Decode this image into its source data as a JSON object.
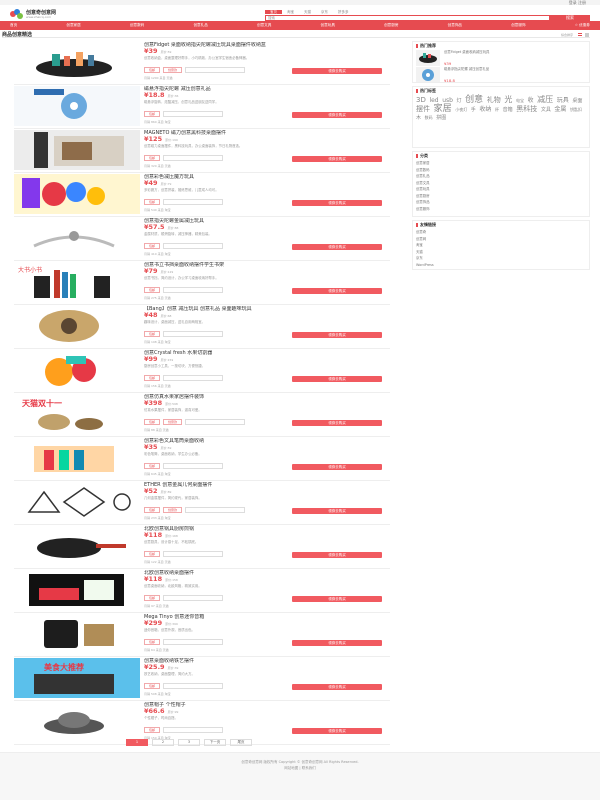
{
  "topbar": {
    "links": "登录  注册"
  },
  "header": {
    "logo_name": "创意奇创意网",
    "logo_sub": "www.zhaicq.com"
  },
  "search": {
    "tabs": [
      "宝贝",
      "淘宝",
      "天猫",
      "京东",
      "拼多多"
    ],
    "placeholder": "搜索",
    "button": "搜索"
  },
  "nav": {
    "items": [
      "首页",
      "创意家居",
      "创意数码",
      "创意礼品",
      "创意文具",
      "创意玩具",
      "创意厨房",
      "创意饰品",
      "创意服饰",
      "☆ 优惠券"
    ]
  },
  "page": {
    "title": "商品创意精选",
    "sort": "综合排序"
  },
  "items": [
    {
      "title": "创意Fidget 桌面收纳指尖陀螺减压玩具桌面摆件收纳盒",
      "price": "¥39",
      "orig": "原价:59",
      "desc": "创意收纳盒，桌面整理好帮手，小巧精致，办公室学生宿舍必备神器。",
      "tags": [
        "包邮",
        "创意款"
      ],
      "buy": "领券去购买",
      "meta": "月销 1200   来自 天猫"
    },
    {
      "title": "磁悬浮指尖陀螺 减压创意礼品",
      "price": "¥18.8",
      "orig": "原价:36",
      "desc": "磁悬浮旋转，炫酷减压，创意礼品送朋友送同学。",
      "tags": [
        "包邮"
      ],
      "buy": "领券去购买",
      "meta": "月销 860   来自 淘宝"
    },
    {
      "title": "MAGNETO 磁力创意黑科技桌面摆件",
      "price": "¥125",
      "orig": "原价:199",
      "desc": "创意磁力桌面摆件，黑科技玩具，办公桌面装饰，节日礼物首选。",
      "tags": [
        "包邮"
      ],
      "buy": "领券去购买",
      "meta": "月销 320   来自 天猫"
    },
    {
      "title": "创意彩色减压魔方玩具",
      "price": "¥49",
      "orig": "原价:79",
      "desc": "多彩魔方，创意拼装，锻炼思维，儿童成人均可。",
      "tags": [
        "包邮"
      ],
      "buy": "领券去购买",
      "meta": "月销 540   来自 淘宝"
    },
    {
      "title": "创意指尖陀螺金属减压玩具",
      "price": "¥57.5",
      "orig": "原价:88",
      "desc": "金属材质，顺滑旋转，减压神器，精美包装。",
      "tags": [
        "包邮"
      ],
      "buy": "领券去购买",
      "meta": "月销 410   来自 淘宝"
    },
    {
      "title": "创意书立书挡桌面收纳摆件学生书架",
      "price": "¥79",
      "orig": "原价:129",
      "desc": "创意书挡，简约设计，办公学习桌面收纳好帮手。",
      "tags": [
        "包邮"
      ],
      "buy": "领券去购买",
      "meta": "月销 275   来自 天猫"
    },
    {
      "title": "【Bang】创意 减压玩具 创意礼品 桌面趣味玩具",
      "price": "¥48",
      "orig": "原价:68",
      "desc": "趣味设计，桌面减压，送礼自用两相宜。",
      "tags": [
        "包邮"
      ],
      "buy": "领券去购买",
      "meta": "月销 198   来自 淘宝"
    },
    {
      "title": "创意Crystal fresh 水果切割器",
      "price": "¥99",
      "orig": "原价:159",
      "desc": "厨房创意小工具，一按切块，方便快捷。",
      "tags": [
        "包邮"
      ],
      "buy": "领券去购买",
      "meta": "月销 156   来自 天猫"
    },
    {
      "title": "创意仿真水果家居摆件装饰",
      "price": "¥398",
      "orig": "原价:598",
      "desc": "仿真水果摆件，家居装饰，逼真可爱。",
      "tags": [
        "包邮",
        "创意款"
      ],
      "buy": "领券去购买",
      "meta": "月销 88   来自 天猫"
    },
    {
      "title": "创意彩色文具笔筒桌面收纳",
      "price": "¥35",
      "orig": "原价:59",
      "desc": "彩色笔筒，桌面收纳，学生办公必备。",
      "tags": [
        "包邮"
      ],
      "buy": "领券去购买",
      "meta": "月销 645   来自 淘宝"
    },
    {
      "title": "ETHER 创意金属几何桌面摆件",
      "price": "¥52",
      "orig": "原价:89",
      "desc": "几何金属摆件，简约现代，家居装饰。",
      "tags": [
        "包邮",
        "创意款"
      ],
      "buy": "领券去购买",
      "meta": "月销 233   来自 淘宝"
    },
    {
      "title": "北欧创意锅具厨房煎锅",
      "price": "¥118",
      "orig": "原价:168",
      "desc": "创意厨具，设计感十足，不粘锅底。",
      "tags": [
        "包邮"
      ],
      "buy": "领券去购买",
      "meta": "月销 122   来自 天猫"
    },
    {
      "title": "北欧创意收纳桌面摆件",
      "price": "¥118",
      "orig": "原价:158",
      "desc": "创意桌面收纳，北欧风格，精致实用。",
      "tags": [
        "包邮"
      ],
      "buy": "领券去购买",
      "meta": "月销 97   来自 天猫"
    },
    {
      "title": "Mega Tinyo 创意迷你音箱",
      "price": "¥299",
      "orig": "原价:399",
      "desc": "迷你音箱，创意外观，音质出色。",
      "tags": [
        "包邮"
      ],
      "buy": "领券去购买",
      "meta": "月销 64   来自 天猫"
    },
    {
      "title": "创意桌面收纳铁艺摆件",
      "price": "¥25.9",
      "orig": "原价:39",
      "desc": "铁艺收纳，桌面整理，简约大方。",
      "tags": [
        "包邮"
      ],
      "buy": "领券去购买",
      "meta": "月销 508   来自 淘宝"
    },
    {
      "title": "创意帽子 个性帽子",
      "price": "¥66.6",
      "orig": "原价:99",
      "desc": "个性帽子，时尚百搭。",
      "tags": [
        "包邮"
      ],
      "buy": "领券去购买",
      "meta": "月销 150   来自 淘宝"
    }
  ],
  "pager": [
    "1",
    "2",
    "3",
    "下一页",
    "尾页"
  ],
  "side": {
    "hot_title": "热门推荐",
    "hot": [
      {
        "text": "创意Fidget 桌面收纳减压玩具",
        "price": "¥39"
      },
      {
        "text": "磁悬浮指尖陀螺 减压创意礼品",
        "price": "¥18.8"
      }
    ],
    "tags_title": "热门标签",
    "tags": [
      "3D",
      "led",
      "usb",
      "灯",
      "创意",
      "礼物",
      "光",
      "电宝",
      "收",
      "减压",
      "玩具",
      "桌面",
      "摆件",
      "家居",
      "小夜灯",
      "手",
      "收纳",
      "杯",
      "音箱",
      "黑科技",
      "文具",
      "金属",
      "钥匙扣",
      "木",
      "数码",
      "拼图"
    ],
    "cat_title": "分类",
    "cats": [
      "创意家居",
      "创意数码",
      "创意礼品",
      "创意文具",
      "创意玩具",
      "创意厨房",
      "创意饰品",
      "创意服饰"
    ],
    "link_title": "友情链接",
    "links": [
      "创意奇",
      "创意网",
      "淘宝",
      "天猫",
      "京东",
      "WordPress"
    ]
  },
  "footer": {
    "line1": "创意奇创意网 版权所有  Copyright © 创意奇创意网 All Rights Reserved.",
    "line2": "网站地图 | 联系我们"
  },
  "colors": {
    "accent": "#e64b50"
  }
}
